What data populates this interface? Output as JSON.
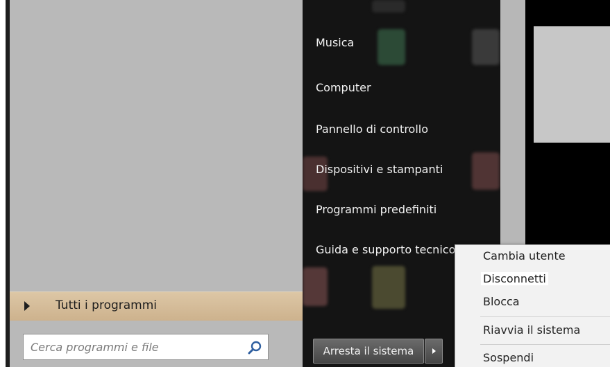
{
  "start_menu": {
    "left_pane": {
      "all_programs_label": "Tutti i programmi",
      "search_placeholder": "Cerca programmi e file"
    },
    "right_pane": {
      "items": [
        {
          "label": "Musica"
        },
        {
          "label": "Computer"
        },
        {
          "label": "Pannello di controllo"
        },
        {
          "label": "Dispositivi e stampanti"
        },
        {
          "label": "Programmi predefiniti"
        },
        {
          "label": "Guida e supporto tecnico"
        }
      ],
      "shutdown_label": "Arresta il sistema"
    },
    "shutdown_submenu": {
      "items": [
        {
          "label": "Cambia utente"
        },
        {
          "label": "Disconnetti",
          "highlighted": true
        },
        {
          "label": "Blocca"
        },
        {
          "label": "Riavvia il sistema"
        },
        {
          "label": "Sospendi"
        }
      ]
    }
  },
  "icons": [
    "search-icon",
    "arrow-right-icon",
    "chevron-right-icon"
  ],
  "colors": {
    "left_pane_bg": "#b9b9b9",
    "all_programs_bg": "#d6bd98",
    "right_pane_bg": "#141414",
    "submenu_bg": "#f2f2f2",
    "search_icon": "#2f5fa0"
  }
}
